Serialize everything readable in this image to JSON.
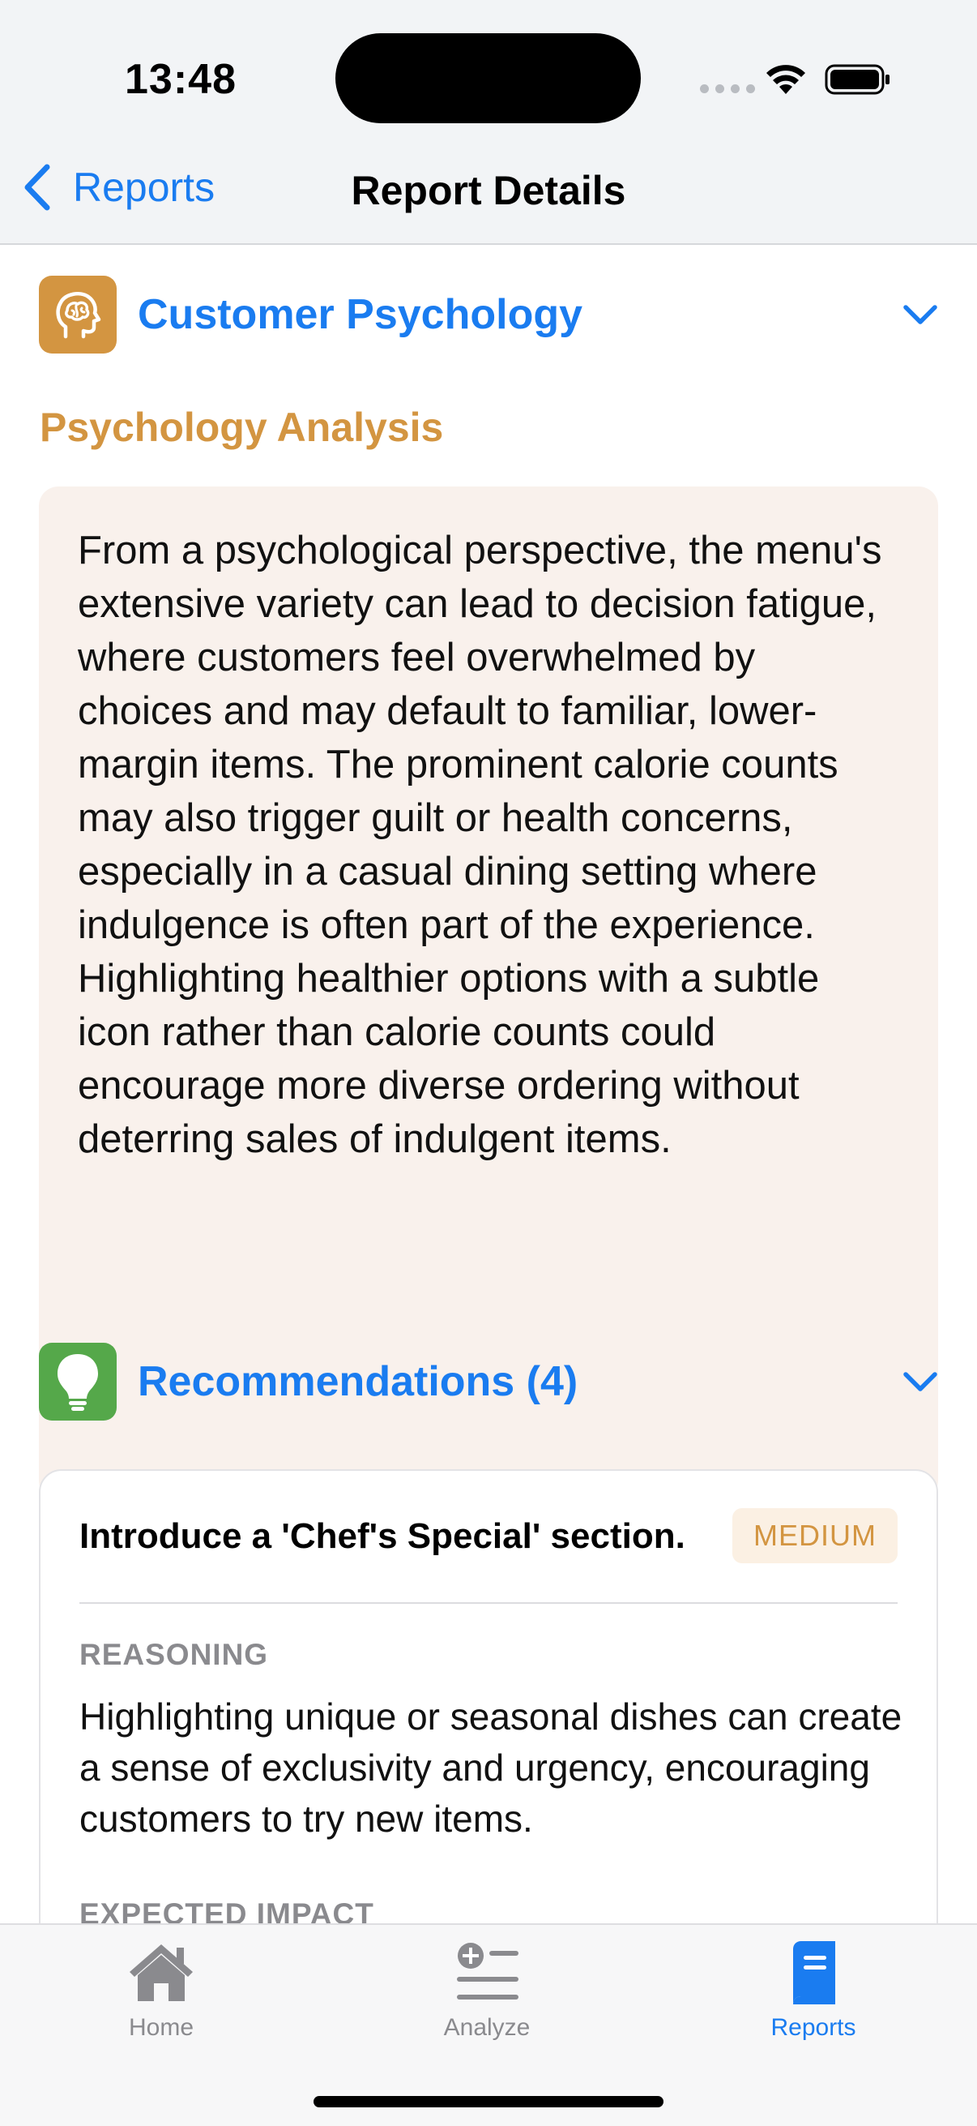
{
  "status_bar": {
    "time": "13:48"
  },
  "nav": {
    "back_label": "Reports",
    "title": "Report Details"
  },
  "psychology": {
    "title": "Customer Psychology",
    "icon": "brain-head-icon",
    "subtitle": "Psychology Analysis",
    "analysis": "From a psychological perspective, the menu's extensive variety can lead to decision fatigue, where customers feel overwhelmed by choices and may default to familiar, lower-margin items. The prominent calorie counts may also trigger guilt or health concerns, especially in a casual dining setting where indulgence is often part of the experience. Highlighting healthier options with a subtle icon rather than calorie counts could encourage more diverse ordering without deterring sales of indulgent items."
  },
  "recommendations": {
    "title": "Recommendations (4)",
    "icon": "lightbulb-icon",
    "items": [
      {
        "title": "Introduce a 'Chef's Special' section.",
        "priority": "MEDIUM",
        "reasoning_label": "REASONING",
        "reasoning": "Highlighting unique or seasonal dishes can create a sense of exclusivity and urgency, encouraging customers to try new items.",
        "impact_label": "EXPECTED IMPACT"
      }
    ]
  },
  "tabbar": {
    "tabs": [
      {
        "label": "Home",
        "icon": "house-icon",
        "active": false
      },
      {
        "label": "Analyze",
        "icon": "list-plus-icon",
        "active": false
      },
      {
        "label": "Reports",
        "icon": "report-book-icon",
        "active": true
      }
    ]
  },
  "colors": {
    "accent": "#1a7cf0",
    "psychology": "#d39541",
    "recommendations": "#55a84a",
    "analysis_bg": "#f9f1ec"
  }
}
